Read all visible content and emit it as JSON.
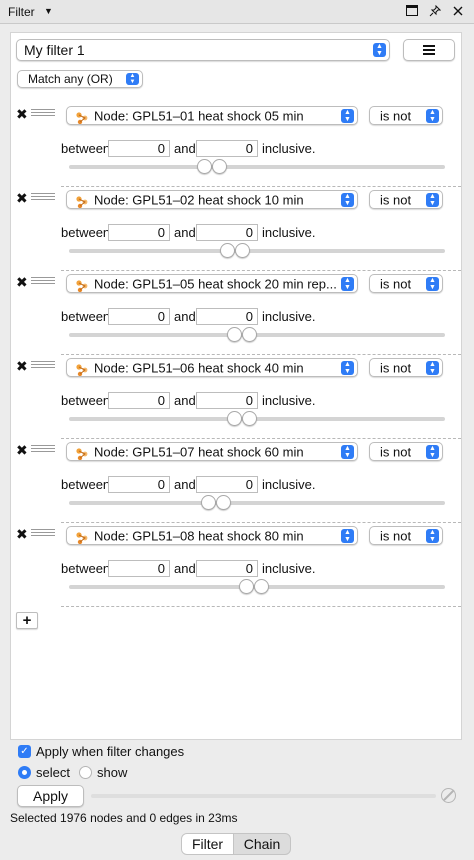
{
  "window": {
    "title": "Filter",
    "icons": [
      "caret-down-icon",
      "maximize-icon",
      "pin-icon",
      "close-icon"
    ]
  },
  "filter": {
    "name": "My filter 1",
    "match_mode": "Match any (OR)"
  },
  "conditions": [
    {
      "column": "Node: GPL51–01 heat shock 05 min",
      "operator": "is not",
      "from_label": "between",
      "from": "0",
      "and_label": "and",
      "to": "0",
      "suffix": "inclusive.",
      "knob1_pct": 0.36,
      "knob2_pct": 0.4
    },
    {
      "column": "Node: GPL51–02 heat shock 10 min",
      "operator": "is not",
      "from_label": "between",
      "from": "0",
      "and_label": "and",
      "to": "0",
      "suffix": "inclusive.",
      "knob1_pct": 0.42,
      "knob2_pct": 0.46
    },
    {
      "column": "Node: GPL51–05 heat shock 20 min rep...",
      "operator": "is not",
      "from_label": "between",
      "from": "0",
      "and_label": "and",
      "to": "0",
      "suffix": "inclusive.",
      "knob1_pct": 0.44,
      "knob2_pct": 0.48
    },
    {
      "column": "Node: GPL51–06 heat shock 40 min",
      "operator": "is not",
      "from_label": "between",
      "from": "0",
      "and_label": "and",
      "to": "0",
      "suffix": "inclusive.",
      "knob1_pct": 0.44,
      "knob2_pct": 0.48
    },
    {
      "column": "Node: GPL51–07 heat shock 60 min",
      "operator": "is not",
      "from_label": "between",
      "from": "0",
      "and_label": "and",
      "to": "0",
      "suffix": "inclusive.",
      "knob1_pct": 0.37,
      "knob2_pct": 0.41
    },
    {
      "column": "Node: GPL51–08 heat shock 80 min",
      "operator": "is not",
      "from_label": "between",
      "from": "0",
      "and_label": "and",
      "to": "0",
      "suffix": "inclusive.",
      "knob1_pct": 0.47,
      "knob2_pct": 0.51
    }
  ],
  "controls": {
    "add_symbol": "+",
    "apply_when_changes": "Apply when filter changes",
    "apply_when_changes_checked": true,
    "select_label": "select",
    "show_label": "show",
    "mode_selected": "select",
    "apply_button": "Apply",
    "status": "Selected 1976 nodes and 0 edges in 23ms"
  },
  "tabs": [
    {
      "label": "Filter",
      "active": true
    },
    {
      "label": "Chain",
      "active": false
    }
  ],
  "colors": {
    "accent": "#2f7cf6",
    "panel_bg": "#ffffff",
    "window_bg": "#ececec"
  }
}
